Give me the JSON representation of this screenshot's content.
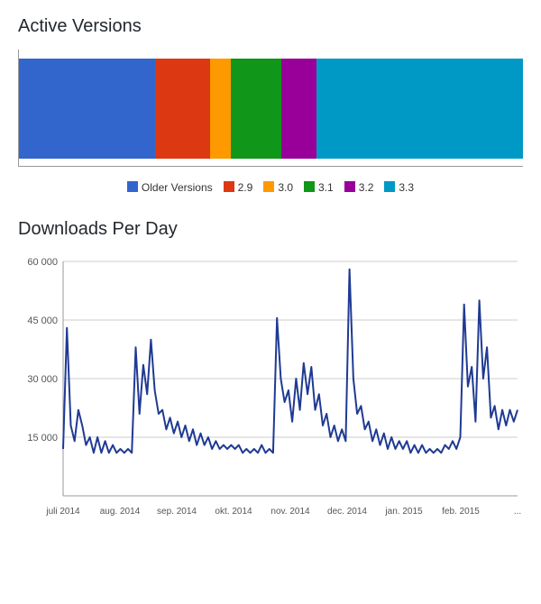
{
  "titles": {
    "active_versions": "Active Versions",
    "downloads_per_day": "Downloads Per Day"
  },
  "chart_data": [
    {
      "type": "bar",
      "orientation": "stacked-horizontal",
      "title": "Active Versions",
      "categories": [
        "Older Versions",
        "2.9",
        "3.0",
        "3.1",
        "3.2",
        "3.3"
      ],
      "values": [
        27,
        11,
        4,
        10,
        7,
        41
      ],
      "colors": [
        "#3366cc",
        "#dc3912",
        "#ff9900",
        "#109618",
        "#990099",
        "#0099c6"
      ],
      "legend_position": "bottom",
      "xlim": [
        0,
        100
      ],
      "ylabel": "",
      "xlabel": ""
    },
    {
      "type": "line",
      "title": "Downloads Per Day",
      "xlabel": "",
      "ylabel": "",
      "ylim": [
        0,
        60000
      ],
      "y_ticks": [
        15000,
        30000,
        45000,
        60000
      ],
      "y_tick_labels": [
        "15 000",
        "30 000",
        "45 000",
        "60 000"
      ],
      "x_tick_labels": [
        "juli 2014",
        "aug. 2014",
        "sep. 2014",
        "okt. 2014",
        "nov. 2014",
        "dec. 2014",
        "jan. 2015",
        "feb. 2015",
        "..."
      ],
      "series": [
        {
          "name": "downloads",
          "color": "#1f3a93",
          "x": [
            0,
            1,
            2,
            3,
            4,
            5,
            6,
            7,
            8,
            9,
            10,
            11,
            12,
            13,
            14,
            15,
            16,
            17,
            18,
            19,
            20,
            21,
            22,
            23,
            24,
            25,
            26,
            27,
            28,
            29,
            30,
            31,
            32,
            33,
            34,
            35,
            36,
            37,
            38,
            39,
            40,
            41,
            42,
            43,
            44,
            45,
            46,
            47,
            48,
            49,
            50,
            51,
            52,
            53,
            54,
            55,
            56,
            57,
            58,
            59,
            60,
            61,
            62,
            63,
            64,
            65,
            66,
            67,
            68,
            69,
            70,
            71,
            72,
            73,
            74,
            75,
            76,
            77,
            78,
            79,
            80,
            81,
            82,
            83,
            84,
            85,
            86,
            87,
            88,
            89,
            90,
            91,
            92,
            93,
            94,
            95,
            96,
            97,
            98,
            99,
            100,
            101,
            102,
            103,
            104,
            105,
            106,
            107,
            108,
            109,
            110,
            111,
            112,
            113,
            114,
            115,
            116,
            117,
            118,
            119
          ],
          "values": [
            12000,
            43000,
            18000,
            14000,
            22000,
            18000,
            13000,
            15000,
            11000,
            15000,
            11000,
            14000,
            11000,
            13000,
            11000,
            12000,
            11000,
            12000,
            11000,
            38000,
            21000,
            33500,
            26000,
            40000,
            27000,
            21000,
            22000,
            17000,
            20000,
            16000,
            19000,
            15000,
            18000,
            14000,
            17000,
            13000,
            16000,
            13000,
            15000,
            12000,
            14000,
            12000,
            13000,
            12000,
            13000,
            12000,
            13000,
            11000,
            12000,
            11000,
            12000,
            11000,
            13000,
            11000,
            12000,
            11000,
            45500,
            30000,
            24000,
            27000,
            19000,
            30000,
            22000,
            34000,
            26000,
            33000,
            22000,
            26000,
            18000,
            21000,
            15000,
            18000,
            14000,
            17000,
            14000,
            58000,
            30000,
            21000,
            23000,
            17000,
            19000,
            14000,
            17000,
            13000,
            16000,
            12000,
            15000,
            12000,
            14000,
            12000,
            14000,
            11000,
            13000,
            11000,
            13000,
            11000,
            12000,
            11000,
            12000,
            11000,
            13000,
            12000,
            14000,
            12000,
            15000,
            49000,
            28000,
            33000,
            19000,
            50000,
            30000,
            38000,
            20000,
            23000,
            17000,
            22000,
            18000,
            22000,
            19000,
            22000
          ]
        }
      ]
    }
  ]
}
